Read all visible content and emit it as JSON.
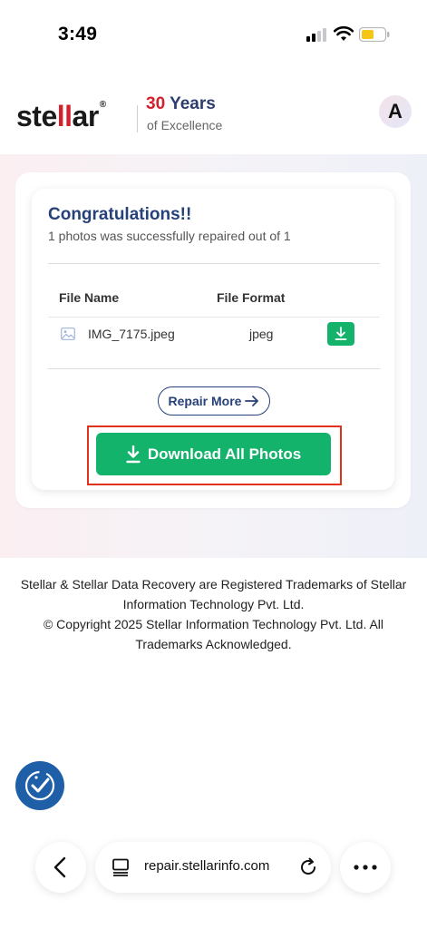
{
  "status_bar": {
    "time": "3:49"
  },
  "header": {
    "logo_prefix": "ste",
    "logo_ll": "ll",
    "logo_suffix": "ar",
    "logo_reg": "®",
    "years_number": "30",
    "years_word": "Years",
    "tagline": "of Excellence",
    "avatar_initial": "A"
  },
  "result": {
    "title": "Congratulations!!",
    "subtitle": "1 photos was successfully repaired out of 1",
    "columns": [
      "File Name",
      "File Format"
    ],
    "files": [
      {
        "name": "IMG_7175.jpeg",
        "format": "jpeg"
      }
    ],
    "repair_more_label": "Repair More",
    "download_all_label": "Download All Photos"
  },
  "footer": {
    "line1": "Stellar & Stellar Data Recovery are Registered Trademarks of Stellar Information Technology Pvt. Ltd.",
    "line2": "© Copyright 2025 Stellar Information Technology Pvt. Ltd. All Trademarks Acknowledged."
  },
  "browser": {
    "url": "repair.stellarinfo.com"
  },
  "colors": {
    "brand_red": "#d4202c",
    "brand_navy": "#26407a",
    "success_green": "#14b36c",
    "highlight_red": "#e0331d",
    "accessibility_blue": "#1e5fa8"
  },
  "icons": {
    "signal": "cellular-signal-icon",
    "wifi": "wifi-icon",
    "battery": "battery-low-power-icon",
    "file": "image-file-icon",
    "download": "download-icon",
    "arrow": "arrow-right-icon",
    "accessibility": "accessibility-icon",
    "back": "chevron-left-icon",
    "tabs": "page-tabs-icon",
    "reload": "reload-icon",
    "more": "more-dots-icon"
  }
}
